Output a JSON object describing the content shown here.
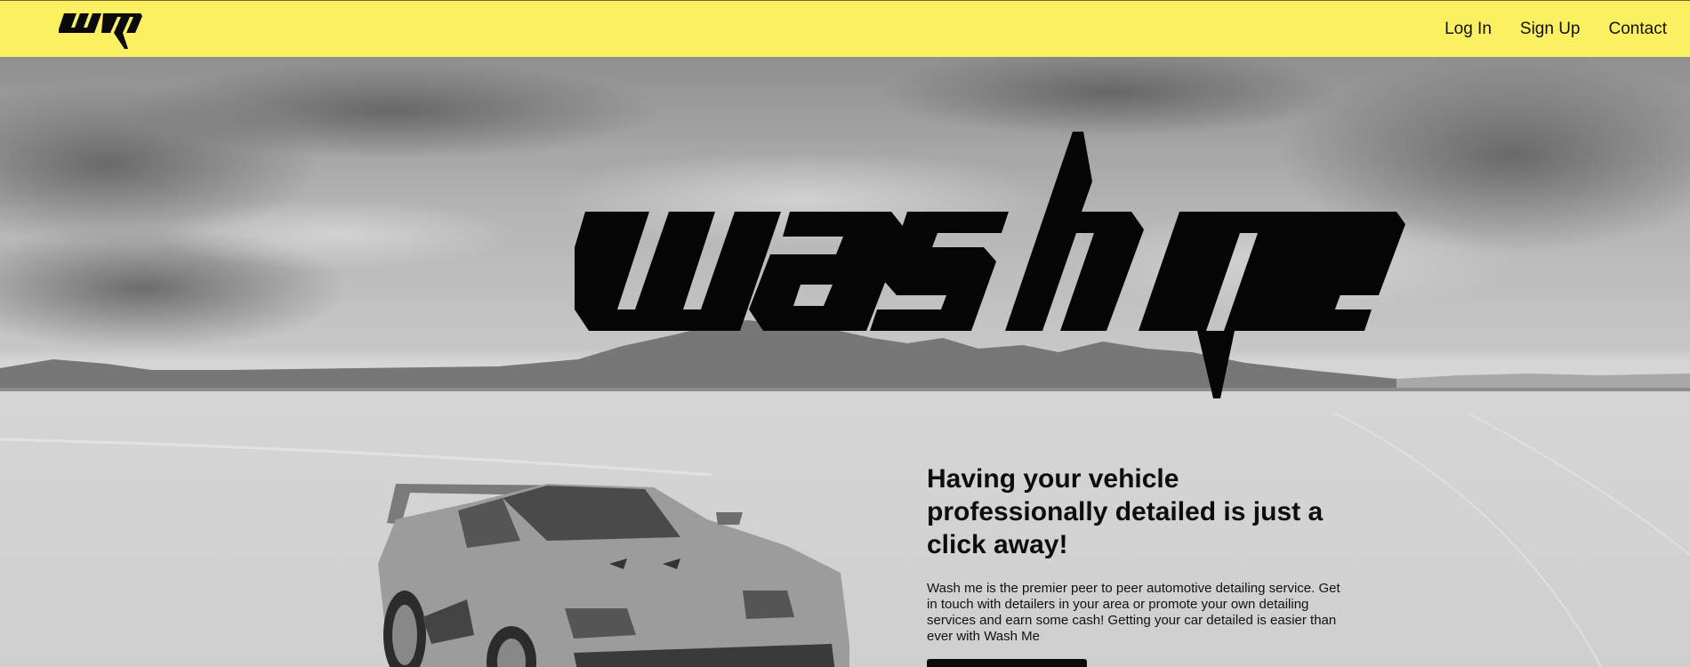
{
  "navbar": {
    "logo_text": "wm",
    "links": [
      {
        "label": "Log In"
      },
      {
        "label": "Sign Up"
      },
      {
        "label": "Contact"
      }
    ],
    "background_color": "#fbef62"
  },
  "hero": {
    "logo_text": "wash me",
    "heading": "Having your vehicle professionally detailed is just a click away!",
    "body": "Wash me is the premier peer to peer automotive detailing service. Get in touch with detailers in your area or promote your own detailing services and earn some cash! Getting your car detailed is easier than ever with Wash Me",
    "background_image": "grayscale-salt-flats-mountains-car-photo",
    "car_image": "white-sports-car-icon"
  }
}
